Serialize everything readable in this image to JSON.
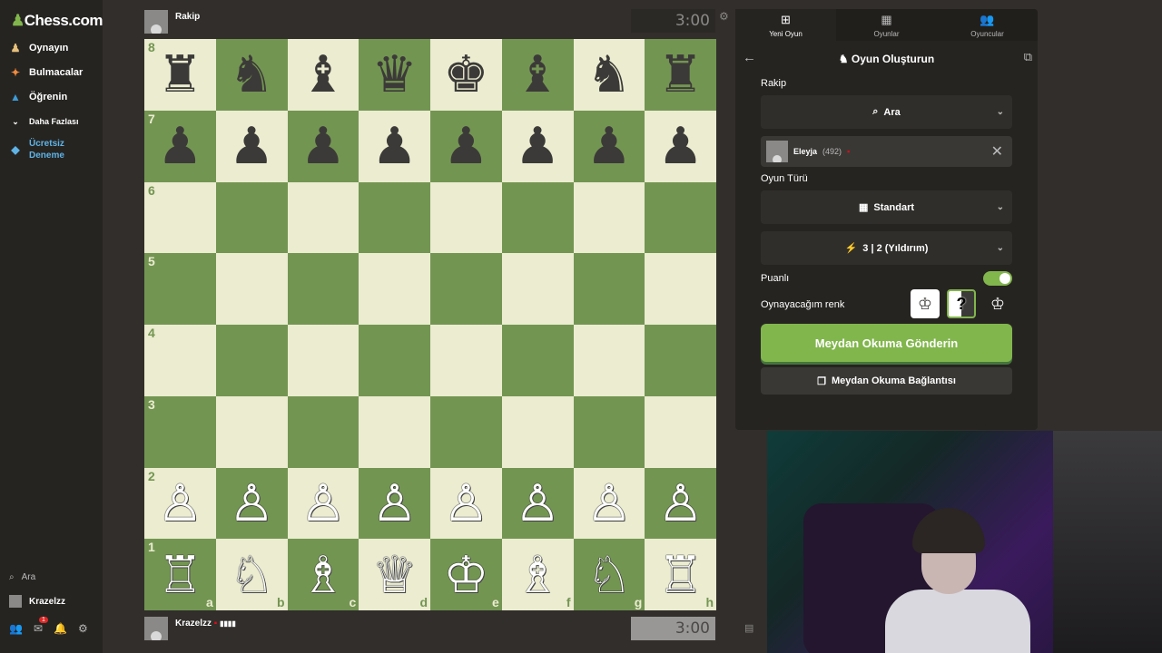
{
  "sidebar": {
    "logo_text": "Chess.com",
    "items": [
      {
        "label": "Oynayın",
        "icon": "play-icon"
      },
      {
        "label": "Bulmacalar",
        "icon": "puzzle-icon"
      },
      {
        "label": "Öğrenin",
        "icon": "learn-icon"
      },
      {
        "label": "Daha Fazlası",
        "icon": "chevron-down-icon"
      },
      {
        "label": "Ücretsiz\nDeneme",
        "icon": "diamond-icon"
      }
    ],
    "search_label": "Ara",
    "user_label": "Krazelzz",
    "notification_count": "1"
  },
  "top_player": {
    "name": "Rakip",
    "clock": "3:00"
  },
  "bottom_player": {
    "name": "Krazelzz",
    "clock": "3:00"
  },
  "board": {
    "ranks": [
      "8",
      "7",
      "6",
      "5",
      "4",
      "3",
      "2",
      "1"
    ],
    "files": [
      "a",
      "b",
      "c",
      "d",
      "e",
      "f",
      "g",
      "h"
    ],
    "rows": [
      [
        "♜",
        "♞",
        "♝",
        "♛",
        "♚",
        "♝",
        "♞",
        "♜"
      ],
      [
        "♟",
        "♟",
        "♟",
        "♟",
        "♟",
        "♟",
        "♟",
        "♟"
      ],
      [
        "",
        "",
        "",
        "",
        "",
        "",
        "",
        ""
      ],
      [
        "",
        "",
        "",
        "",
        "",
        "",
        "",
        ""
      ],
      [
        "",
        "",
        "",
        "",
        "",
        "",
        "",
        ""
      ],
      [
        "",
        "",
        "",
        "",
        "",
        "",
        "",
        ""
      ],
      [
        "♙",
        "♙",
        "♙",
        "♙",
        "♙",
        "♙",
        "♙",
        "♙"
      ],
      [
        "♖",
        "♘",
        "♗",
        "♕",
        "♔",
        "♗",
        "♘",
        "♖"
      ]
    ]
  },
  "panel": {
    "tabs": [
      {
        "label": "Yeni Oyun",
        "icon": "plus-square-icon"
      },
      {
        "label": "Oyunlar",
        "icon": "board-icon"
      },
      {
        "label": "Oyuncular",
        "icon": "users-icon"
      }
    ],
    "title": "Oyun Oluşturun",
    "opponent_label": "Rakip",
    "opponent_search": "Ara",
    "opponent_name": "Eleyja",
    "opponent_rating": "(492)",
    "game_type_label": "Oyun Türü",
    "game_type": "Standart",
    "time_control": "3 | 2 (Yıldırım)",
    "rated_label": "Puanlı",
    "color_label": "Oynayacağım renk",
    "cta_label": "Meydan Okuma Gönderin",
    "link_label": "Meydan Okuma Bağlantısı"
  },
  "colors": {
    "accent": "#81b64c",
    "board_light": "#ebecd0",
    "board_dark": "#739552"
  }
}
